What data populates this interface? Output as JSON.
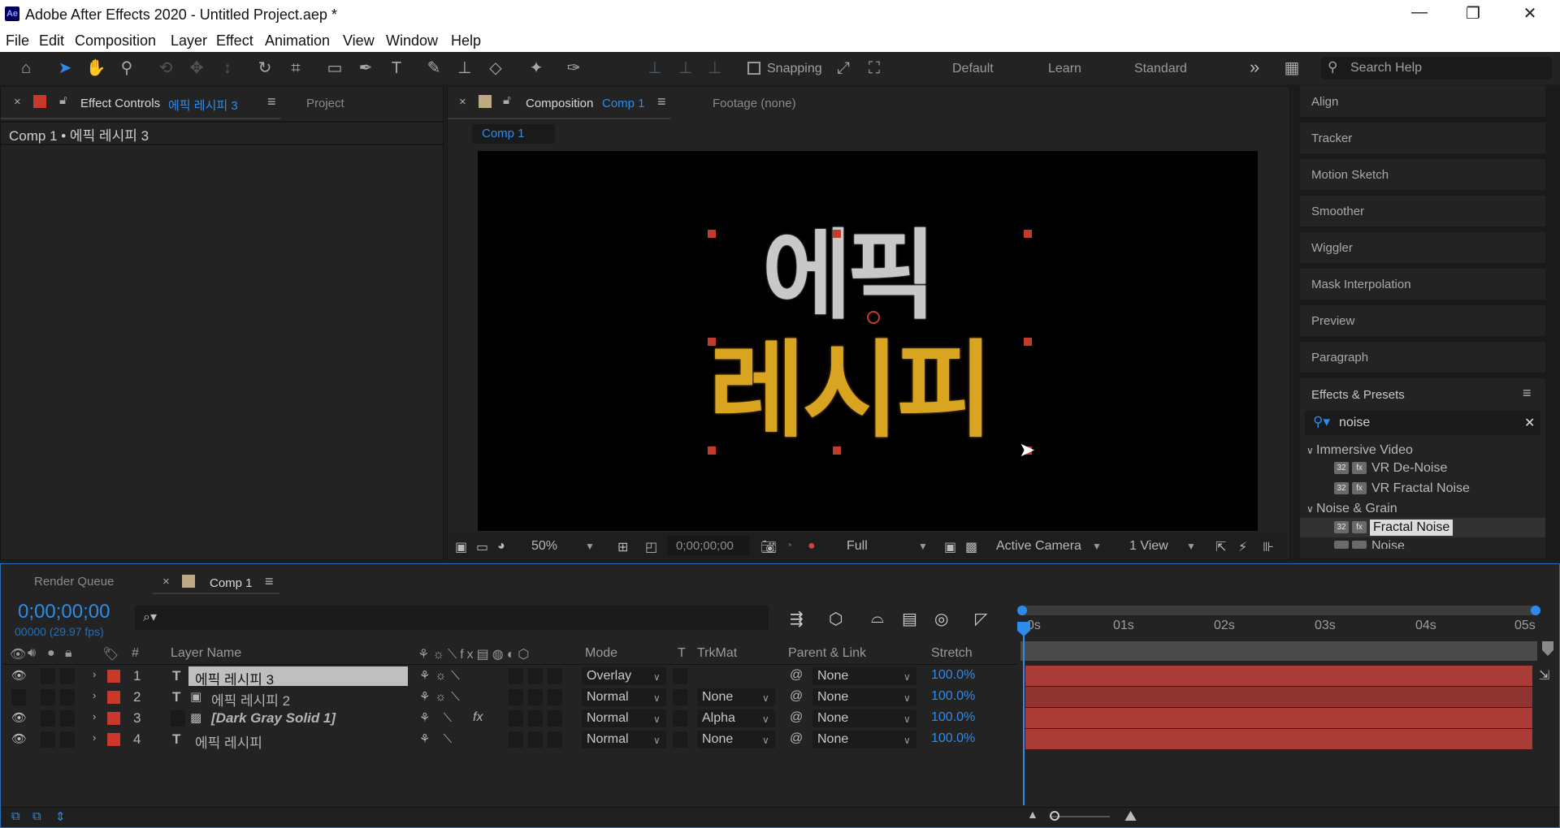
{
  "window": {
    "title": "Adobe After Effects 2020 - Untitled Project.aep *",
    "logo": "Ae",
    "min": "—",
    "restore": "❐",
    "close": "✕"
  },
  "menu": [
    "File",
    "Edit",
    "Composition",
    "Layer",
    "Effect",
    "Animation",
    "View",
    "Window",
    "Help"
  ],
  "toolbar": {
    "snapping": "Snapping",
    "workspaces": [
      "Default",
      "Learn",
      "Standard"
    ],
    "more": "»",
    "search_placeholder": "Search Help"
  },
  "effect_controls": {
    "close": "×",
    "tab": "Effect Controls",
    "layer": "에픽 레시피 3",
    "project_tab": "Project",
    "breadcrumb": "Comp 1 • 에픽 레시피 3"
  },
  "composition": {
    "close": "×",
    "tab": "Composition",
    "name": "Comp 1",
    "footage": "Footage  (none)",
    "subtab": "Comp 1"
  },
  "viewer": {
    "text_line1": "에픽",
    "text_line2": "레시피",
    "zoom": "50%",
    "timecode": "0;00;00;00",
    "resolution": "Full",
    "camera": "Active Camera",
    "views": "1 View"
  },
  "right_panels": [
    "Align",
    "Tracker",
    "Motion Sketch",
    "Smoother",
    "Wiggler",
    "Mask Interpolation",
    "Preview",
    "Paragraph"
  ],
  "effects_presets": {
    "title": "Effects & Presets",
    "search": "noise",
    "clear": "✕",
    "groups": [
      {
        "name": "Immersive Video",
        "items": [
          "VR De-Noise",
          "VR Fractal Noise"
        ]
      },
      {
        "name": "Noise & Grain",
        "items": [
          "Fractal Noise",
          "Noise"
        ]
      }
    ]
  },
  "timeline": {
    "render_queue": "Render Queue",
    "close": "×",
    "comp_tab": "Comp 1",
    "timecode": "0;00;00;00",
    "fps": "00000 (29.97 fps)",
    "search_icon": "⌕▾",
    "columns": {
      "num": "#",
      "layer_name": "Layer Name",
      "mode": "Mode",
      "t": "T",
      "trkmat": "TrkMat",
      "parent": "Parent & Link",
      "stretch": "Stretch"
    },
    "ticks": [
      "0s",
      "01s",
      "02s",
      "03s",
      "04s",
      "05s"
    ],
    "layers": [
      {
        "num": "1",
        "type": "T",
        "name": "에픽 레시피 3",
        "mode": "Overlay",
        "trkmat": "",
        "parent": "None",
        "stretch": "100.0%",
        "visible": true,
        "fx": ""
      },
      {
        "num": "2",
        "type": "T",
        "name": "에픽 레시피 2",
        "mode": "Normal",
        "trkmat": "None",
        "parent": "None",
        "stretch": "100.0%",
        "visible": false,
        "fx": ""
      },
      {
        "num": "3",
        "type": "",
        "name": "[Dark Gray Solid 1]",
        "mode": "Normal",
        "trkmat": "Alpha",
        "parent": "None",
        "stretch": "100.0%",
        "visible": true,
        "fx": "fx"
      },
      {
        "num": "4",
        "type": "T",
        "name": "에픽 레시피",
        "mode": "Normal",
        "trkmat": "None",
        "parent": "None",
        "stretch": "100.0%",
        "visible": true,
        "fx": ""
      }
    ]
  },
  "colors": {
    "accent": "#2d8ceb",
    "layer_label": "#c9382a",
    "layer_bar": "#ab3b37",
    "gold": "#d9a520",
    "silver": "#c8c8c8"
  }
}
